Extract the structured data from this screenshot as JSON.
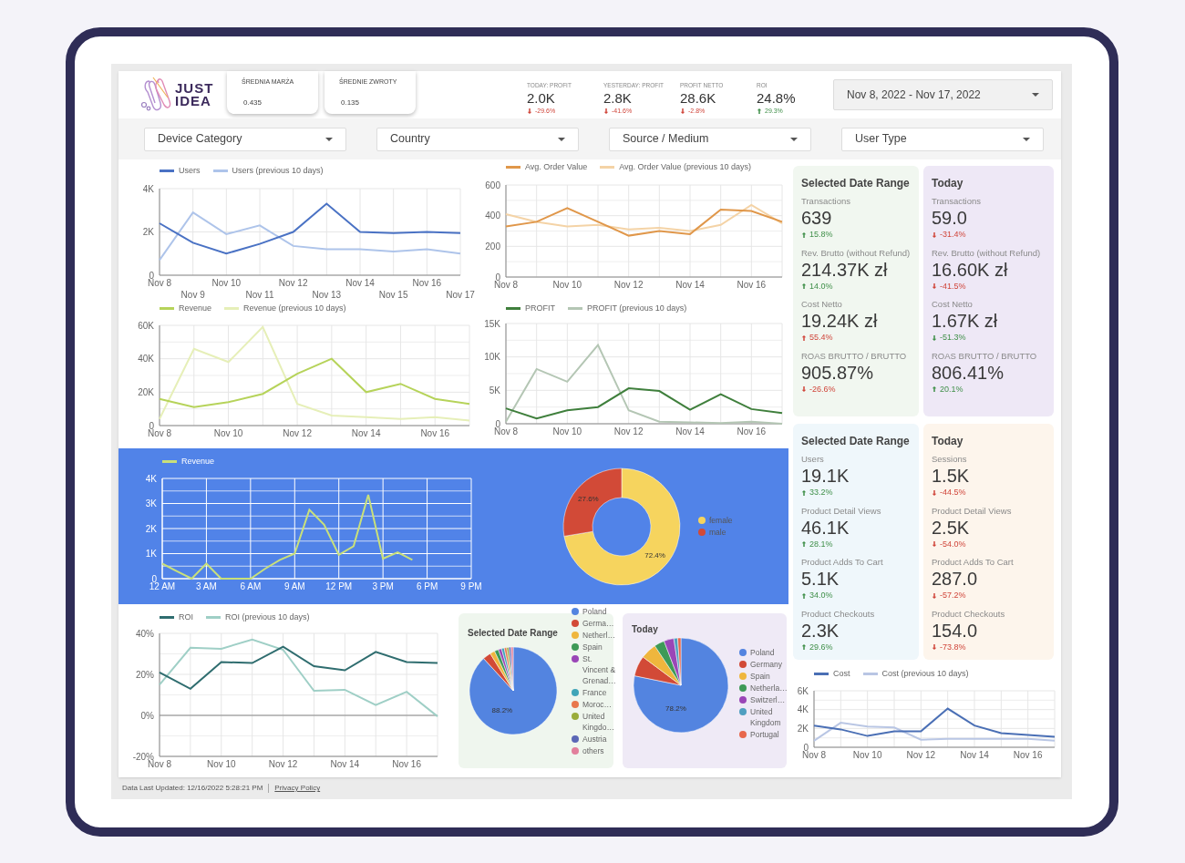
{
  "logo": {
    "line_1": "JUST",
    "line_2": "IDEA"
  },
  "header_cards": [
    {
      "label": "ŚREDNIA MARŻA",
      "value": "0.435"
    },
    {
      "label": "ŚREDNIE ZWROTY",
      "value": "0.135"
    }
  ],
  "header_kpis": [
    {
      "label": "TODAY: PROFIT",
      "value": "2.0K",
      "change": "-29.6%",
      "up": false,
      "good": false
    },
    {
      "label": "YESTERDAY: PROFIT",
      "value": "2.8K",
      "change": "-41.6%",
      "up": false,
      "good": false
    },
    {
      "label": "PROFIT NETTO",
      "value": "28.6K",
      "change": "-2.8%",
      "up": false,
      "good": false
    },
    {
      "label": "ROI",
      "value": "24.8%",
      "change": "29.3%",
      "up": true,
      "good": true
    }
  ],
  "date_range": {
    "value": "Nov 8, 2022 - Nov 17, 2022"
  },
  "filters": [
    {
      "label": "Device Category"
    },
    {
      "label": "Country"
    },
    {
      "label": "Source / Medium"
    },
    {
      "label": "User Type"
    }
  ],
  "users_chart": {
    "chart_data": {
      "type": "line",
      "grid": true,
      "categories": [
        "Nov 8",
        "Nov 9",
        "Nov 10",
        "Nov 11",
        "Nov 12",
        "Nov 13",
        "Nov 14",
        "Nov 15",
        "Nov 16",
        "Nov 17"
      ],
      "ylim": [
        0,
        4000
      ],
      "yticks": [
        {
          "value": 0,
          "label": "0"
        },
        {
          "value": 2000,
          "label": "2K"
        },
        {
          "value": 4000,
          "label": "4K"
        }
      ],
      "series": [
        {
          "name": "Users",
          "color": "#4a72c4",
          "values": [
            2400,
            1500,
            1000,
            1450,
            2000,
            3300,
            2000,
            1950,
            2000,
            1950
          ]
        },
        {
          "name": "Users (previous 10 days)",
          "color": "#aec4ea",
          "values": [
            700,
            2900,
            1900,
            2300,
            1350,
            1200,
            1200,
            1100,
            1200,
            1000
          ]
        }
      ]
    }
  },
  "aov_chart": {
    "chart_data": {
      "type": "line",
      "grid": true,
      "categories": [
        "Nov 8",
        null,
        "Nov 10",
        null,
        "Nov 12",
        null,
        "Nov 14",
        null,
        "Nov 16",
        null
      ],
      "ylim": [
        0,
        600
      ],
      "yticks": [
        0,
        200,
        400,
        600
      ],
      "series": [
        {
          "name": "Avg. Order Value",
          "color": "#e0974a",
          "values": [
            330,
            360,
            450,
            360,
            270,
            300,
            280,
            440,
            430,
            360
          ]
        },
        {
          "name": "Avg. Order Value (previous 10 days)",
          "color": "#f4d3a6",
          "values": [
            410,
            360,
            330,
            340,
            310,
            320,
            300,
            340,
            470,
            350
          ]
        }
      ]
    }
  },
  "revenue_chart": {
    "chart_data": {
      "type": "line",
      "grid": true,
      "categories": [
        "Nov 8",
        null,
        "Nov 10",
        null,
        "Nov 12",
        null,
        "Nov 14",
        null,
        "Nov 16",
        null
      ],
      "ylim": [
        0,
        60000
      ],
      "yticks": [
        {
          "value": 0,
          "label": "0"
        },
        {
          "value": 20000,
          "label": "20K"
        },
        {
          "value": 40000,
          "label": "40K"
        },
        {
          "value": 60000,
          "label": "60K"
        }
      ],
      "series": [
        {
          "name": "Revenue",
          "color": "#b6d35a",
          "values": [
            16000,
            11000,
            14000,
            19000,
            31000,
            40000,
            20000,
            25000,
            16000,
            13000
          ]
        },
        {
          "name": "Revenue (previous 10 days)",
          "color": "#e6efb8",
          "values": [
            4000,
            46000,
            38000,
            59000,
            13000,
            6000,
            5000,
            4000,
            5000,
            3000
          ]
        }
      ]
    }
  },
  "profit_chart": {
    "chart_data": {
      "type": "line",
      "grid": true,
      "categories": [
        "Nov 8",
        null,
        "Nov 10",
        null,
        "Nov 12",
        null,
        "Nov 14",
        null,
        "Nov 16",
        null
      ],
      "ylim": [
        0,
        15000
      ],
      "yticks": [
        {
          "value": 0,
          "label": "0"
        },
        {
          "value": 5000,
          "label": "5K"
        },
        {
          "value": 10000,
          "label": "10K"
        },
        {
          "value": 15000,
          "label": "15K"
        }
      ],
      "series": [
        {
          "name": "PROFIT",
          "color": "#3f7f3c",
          "values": [
            2300,
            800,
            2000,
            2500,
            5300,
            4900,
            2100,
            4400,
            2200,
            1600
          ]
        },
        {
          "name": "PROFIT (previous 10 days)",
          "color": "#b4c6b4",
          "values": [
            300,
            8200,
            6300,
            11800,
            2000,
            300,
            200,
            100,
            300,
            0
          ]
        }
      ]
    }
  },
  "hourly_chart": {
    "chart_data": {
      "type": "line",
      "grid": true,
      "categories": [
        "12 AM",
        null,
        null,
        "3 AM",
        null,
        null,
        "6 AM",
        null,
        null,
        "9 AM",
        null,
        null,
        "12 PM",
        null,
        null,
        "3 PM",
        null,
        null,
        "6 PM",
        null,
        null,
        "9 PM"
      ],
      "ylim": [
        0,
        4000
      ],
      "yticks": [
        {
          "value": 0,
          "label": "0"
        },
        {
          "value": 1000,
          "label": "1K"
        },
        {
          "value": 2000,
          "label": "2K"
        },
        {
          "value": 3000,
          "label": "3K"
        },
        {
          "value": 4000,
          "label": "4K"
        }
      ],
      "series": [
        {
          "name": "Revenue",
          "color": "#c9e07a",
          "values": [
            600,
            300,
            0,
            600,
            0,
            0,
            0,
            400,
            750,
            1000,
            2750,
            2150,
            950,
            1300,
            3350,
            800,
            1050,
            750,
            null,
            null,
            null,
            null
          ]
        }
      ]
    }
  },
  "gender_chart": {
    "chart_data": {
      "type": "donut",
      "categories": [
        "female",
        "male"
      ],
      "values": [
        72.4,
        27.6
      ],
      "colors": [
        "#f6d45e",
        "#d24a37"
      ],
      "value_labels": [
        "72.4%",
        "27.6%"
      ]
    }
  },
  "roi_chart": {
    "chart_data": {
      "type": "line",
      "grid": true,
      "categories": [
        "Nov 8",
        null,
        "Nov 10",
        null,
        "Nov 12",
        null,
        "Nov 14",
        null,
        "Nov 16",
        null
      ],
      "ylim": [
        -20,
        40
      ],
      "yticks": [
        {
          "value": -20,
          "label": "-20%"
        },
        {
          "value": 0,
          "label": "0%"
        },
        {
          "value": 20,
          "label": "20%"
        },
        {
          "value": 40,
          "label": "40%"
        }
      ],
      "series": [
        {
          "name": "ROI",
          "color": "#2f6d6f",
          "values": [
            21,
            13,
            26,
            25.5,
            33.5,
            24,
            22,
            31,
            26,
            25.5
          ]
        },
        {
          "name": "ROI (previous 10 days)",
          "color": "#9fcfc6",
          "values": [
            15,
            33,
            32.5,
            37,
            32,
            12,
            12.5,
            5,
            11.5,
            -0.5
          ]
        }
      ]
    }
  },
  "country_cards": [
    {
      "title": "Selected Date Range",
      "color": "#eff6ee",
      "chart_data": {
        "type": "pie",
        "categories": [
          "Poland",
          "Germa…",
          "Netherl…",
          "Spain",
          "St. Vincent & Grenad…",
          "France",
          "Moroc…",
          "United Kingdo…",
          "Austria",
          "others"
        ],
        "values": [
          88.2,
          3.0,
          1.8,
          1.5,
          1.2,
          1.0,
          0.9,
          0.8,
          0.8,
          0.8
        ],
        "colors": [
          "#5384e0",
          "#d24a37",
          "#efb63d",
          "#3e9a57",
          "#9a46b7",
          "#3fa5b8",
          "#e8774c",
          "#9aac3b",
          "#5b67b6",
          "#e27f9c"
        ],
        "value_labels": [
          "88.2%",
          null,
          null,
          null,
          null,
          null,
          null,
          null,
          null,
          null
        ]
      }
    },
    {
      "title": "Today",
      "color": "#efeaf6",
      "chart_data": {
        "type": "pie",
        "categories": [
          "Poland",
          "Germany",
          "Spain",
          "Netherla…",
          "Switzerl…",
          "United Kingdom",
          "Portugal"
        ],
        "values": [
          78.2,
          7.0,
          5.5,
          3.5,
          3.4,
          1.3,
          1.1
        ],
        "colors": [
          "#5384e0",
          "#d24a37",
          "#efb63d",
          "#3e9a57",
          "#9a46b7",
          "#4f9fc0",
          "#e8674c"
        ],
        "value_labels": [
          "78.2%",
          null,
          null,
          null,
          null,
          null,
          null
        ]
      }
    }
  ],
  "stat_cards": [
    {
      "title": "Selected Date Range",
      "color": "#f1f7f0",
      "metrics": [
        {
          "label": "Transactions",
          "value": "639",
          "change": "15.8%",
          "up": true,
          "good": true
        },
        {
          "label": "Rev. Brutto (without Refund)",
          "value": "214.37K zł",
          "change": "14.0%",
          "up": true,
          "good": true
        },
        {
          "label": "Cost Netto",
          "value": "19.24K zł",
          "change": "55.4%",
          "up": true,
          "good": false
        },
        {
          "label": "ROAS BRUTTO / BRUTTO",
          "value": "905.87%",
          "change": "-26.6%",
          "up": false,
          "good": false
        }
      ]
    },
    {
      "title": "Today",
      "color": "#eee8f6",
      "metrics": [
        {
          "label": "Transactions",
          "value": "59.0",
          "change": "-31.4%",
          "up": false,
          "good": false
        },
        {
          "label": "Rev. Brutto (without Refund)",
          "value": "16.60K zł",
          "change": "-41.5%",
          "up": false,
          "good": false
        },
        {
          "label": "Cost Netto",
          "value": "1.67K zł",
          "change": "-51.3%",
          "up": false,
          "good": true
        },
        {
          "label": "ROAS BRUTTO / BRUTTO",
          "value": "806.41%",
          "change": "20.1%",
          "up": true,
          "good": true
        }
      ]
    },
    {
      "title": "Selected Date Range",
      "color": "#eff7fb",
      "metrics": [
        {
          "label": "Users",
          "value": "19.1K",
          "change": "33.2%",
          "up": true,
          "good": true
        },
        {
          "label": "Product Detail Views",
          "value": "46.1K",
          "change": "28.1%",
          "up": true,
          "good": true
        },
        {
          "label": "Product Adds To Cart",
          "value": "5.1K",
          "change": "34.0%",
          "up": true,
          "good": true
        },
        {
          "label": "Product Checkouts",
          "value": "2.3K",
          "change": "29.6%",
          "up": true,
          "good": true
        }
      ]
    },
    {
      "title": "Today",
      "color": "#fdf5ec",
      "metrics": [
        {
          "label": "Sessions",
          "value": "1.5K",
          "change": "-44.5%",
          "up": false,
          "good": false
        },
        {
          "label": "Product Detail Views",
          "value": "2.5K",
          "change": "-54.0%",
          "up": false,
          "good": false
        },
        {
          "label": "Product Adds To Cart",
          "value": "287.0",
          "change": "-57.2%",
          "up": false,
          "good": false
        },
        {
          "label": "Product Checkouts",
          "value": "154.0",
          "change": "-73.8%",
          "up": false,
          "good": false
        }
      ]
    }
  ],
  "cost_chart": {
    "chart_data": {
      "type": "line",
      "grid": true,
      "categories": [
        "Nov 8",
        null,
        "Nov 10",
        null,
        "Nov 12",
        null,
        "Nov 14",
        null,
        "Nov 16",
        null
      ],
      "ylim": [
        0,
        6000
      ],
      "yticks": [
        {
          "value": 0,
          "label": "0"
        },
        {
          "value": 2000,
          "label": "2K"
        },
        {
          "value": 4000,
          "label": "4K"
        },
        {
          "value": 6000,
          "label": "6K"
        }
      ],
      "series": [
        {
          "name": "Cost",
          "color": "#4a6fb5",
          "values": [
            2300,
            1900,
            1200,
            1700,
            1700,
            4100,
            2300,
            1500,
            1300,
            1100
          ]
        },
        {
          "name": "Cost (previous 10 days)",
          "color": "#b9c6e4",
          "values": [
            700,
            2600,
            2200,
            2100,
            800,
            900,
            900,
            900,
            900,
            700
          ]
        }
      ]
    }
  },
  "footer": {
    "updated": "Data Last Updated: 12/16/2022 5:28:21 PM",
    "link": "Privacy Policy"
  }
}
